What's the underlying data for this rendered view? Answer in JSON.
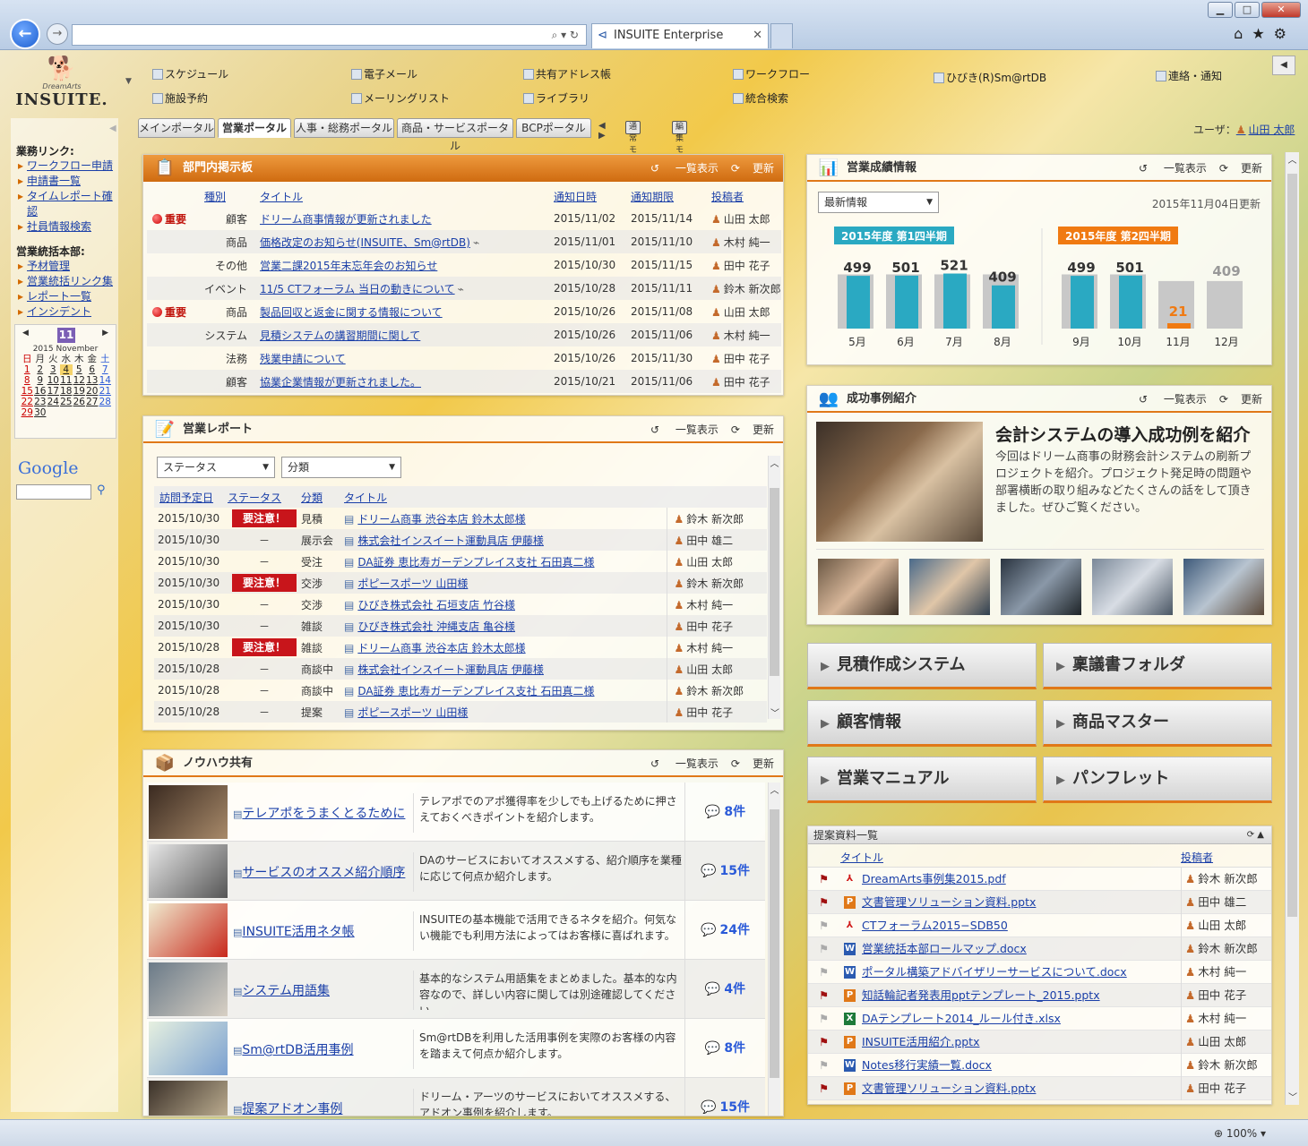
{
  "browser": {
    "address": "",
    "tab_title": "INSUITE Enterprise",
    "zoom": "100%"
  },
  "logo": {
    "sub": "DreamArts",
    "brand": "INSUITE."
  },
  "menu": [
    "スケジュール",
    "施設予約",
    "電子メール",
    "メーリングリスト",
    "共有アドレス帳",
    "ライブラリ",
    "ワークフロー",
    "統合検索",
    "ひびき(R)Sm@rtDB",
    "連絡・通知"
  ],
  "tabs": [
    "メインポータル",
    "営業ポータル",
    "人事・総務ポータル",
    "商品・サービスポータル",
    "BCPポータル"
  ],
  "modes": [
    "通常モード",
    "編集モード"
  ],
  "user": {
    "label": "ユーザ：",
    "name": "山田 太郎"
  },
  "sidebar": {
    "group1": {
      "title": "業務リンク:",
      "items": [
        "ワークフロー申請",
        "申請書一覧",
        "タイムレポート確認",
        "社員情報検索"
      ]
    },
    "group2": {
      "title": "営業統括本部:",
      "items": [
        "予材管理",
        "営業統括リンク集",
        "レポート一覧",
        "インシデント"
      ]
    },
    "calendar": {
      "month_num": "11",
      "month_label": "2015 November",
      "weekdays": [
        "日",
        "月",
        "火",
        "水",
        "木",
        "金",
        "土"
      ],
      "days": [
        "1",
        "2",
        "3",
        "4",
        "5",
        "6",
        "7",
        "8",
        "9",
        "10",
        "11",
        "12",
        "13",
        "14",
        "15",
        "16",
        "17",
        "18",
        "19",
        "20",
        "21",
        "22",
        "23",
        "24",
        "25",
        "26",
        "27",
        "28",
        "29",
        "30"
      ]
    },
    "google": "Google"
  },
  "bulletin": {
    "title": "部門内掲示板",
    "list_label": "一覧表示",
    "refresh_label": "更新",
    "headers": [
      "種別",
      "タイトル",
      "通知日時",
      "通知期限",
      "投稿者"
    ],
    "rows": [
      {
        "flag": "重要",
        "type": "顧客",
        "title": "ドリーム商事情報が更新されました",
        "date": "2015/11/02",
        "limit": "2015/11/14",
        "author": "山田 太郎"
      },
      {
        "flag": "",
        "type": "商品",
        "title": "価格改定のお知らせ(INSUITE、Sm@rtDB)",
        "date": "2015/11/01",
        "limit": "2015/11/10",
        "author": "木村 純一"
      },
      {
        "flag": "",
        "type": "その他",
        "title": "営業二課2015年末忘年会のお知らせ",
        "date": "2015/10/30",
        "limit": "2015/11/15",
        "author": "田中 花子"
      },
      {
        "flag": "",
        "type": "イベント",
        "title": "11/5 CTフォーラム 当日の動きについて",
        "date": "2015/10/28",
        "limit": "2015/11/11",
        "author": "鈴木 新次郎"
      },
      {
        "flag": "重要",
        "type": "商品",
        "title": "製品回収と返金に関する情報について",
        "date": "2015/10/26",
        "limit": "2015/11/08",
        "author": "山田 太郎"
      },
      {
        "flag": "",
        "type": "システム",
        "title": "見積システムの講習期間に関して",
        "date": "2015/10/26",
        "limit": "2015/11/06",
        "author": "木村 純一"
      },
      {
        "flag": "",
        "type": "法務",
        "title": "残業申請について",
        "date": "2015/10/26",
        "limit": "2015/11/30",
        "author": "田中 花子"
      },
      {
        "flag": "",
        "type": "顧客",
        "title": "協業企業情報が更新されました。",
        "date": "2015/10/21",
        "limit": "2015/11/06",
        "author": "田中 花子"
      }
    ]
  },
  "reports": {
    "title": "営業レポート",
    "list_label": "一覧表示",
    "refresh_label": "更新",
    "filter1": "ステータス",
    "filter2": "分類",
    "headers": [
      "訪問予定日",
      "ステータス",
      "分類",
      "タイトル"
    ],
    "rows": [
      {
        "date": "2015/10/30",
        "status": "要注意！",
        "cat": "見積",
        "title": "ドリーム商事 渋谷本店 鈴木太郎様",
        "author": "鈴木 新次郎"
      },
      {
        "date": "2015/10/30",
        "status": "－",
        "cat": "展示会",
        "title": "株式会社インスイート運動具店 伊藤様",
        "author": "田中 雄二"
      },
      {
        "date": "2015/10/30",
        "status": "－",
        "cat": "受注",
        "title": "DA証券 恵比寿ガーデンプレイス支社 石田真二様",
        "author": "山田 太郎"
      },
      {
        "date": "2015/10/30",
        "status": "要注意！",
        "cat": "交渉",
        "title": "ポピースポーツ 山田様",
        "author": "鈴木 新次郎"
      },
      {
        "date": "2015/10/30",
        "status": "－",
        "cat": "交渉",
        "title": "ひびき株式会社 石垣支店 竹谷様",
        "author": "木村 純一"
      },
      {
        "date": "2015/10/30",
        "status": "－",
        "cat": "雑談",
        "title": "ひびき株式会社 沖縄支店 亀谷様",
        "author": "田中 花子"
      },
      {
        "date": "2015/10/28",
        "status": "要注意！",
        "cat": "雑談",
        "title": "ドリーム商事 渋谷本店 鈴木太郎様",
        "author": "木村 純一"
      },
      {
        "date": "2015/10/28",
        "status": "－",
        "cat": "商談中",
        "title": "株式会社インスイート運動具店 伊藤様",
        "author": "山田 太郎"
      },
      {
        "date": "2015/10/28",
        "status": "－",
        "cat": "商談中",
        "title": "DA証券 恵比寿ガーデンプレイス支社 石田真二様",
        "author": "鈴木 新次郎"
      },
      {
        "date": "2015/10/28",
        "status": "－",
        "cat": "提案",
        "title": "ポピースポーツ 山田様",
        "author": "田中 花子"
      }
    ]
  },
  "knowhow": {
    "title": "ノウハウ共有",
    "list_label": "一覧表示",
    "refresh_label": "更新",
    "rows": [
      {
        "title": "テレアポをうまくとるために",
        "desc": "テレアポでのアポ獲得率を少しでも上げるために押さえておくべきポイントを紹介します。",
        "count": "8件"
      },
      {
        "title": "サービスのオススメ紹介順序",
        "desc": "DAのサービスにおいてオススメする、紹介順序を業種に応じて何点か紹介します。",
        "count": "15件"
      },
      {
        "title": "INSUITE活用ネタ帳",
        "desc": "INSUITEの基本機能で活用できるネタを紹介。何気ない機能でも利用方法によってはお客様に喜ばれます。",
        "count": "24件"
      },
      {
        "title": "システム用語集",
        "desc": "基本的なシステム用語集をまとめました。基本的な内容なので、詳しい内容に関しては別途確認してください。",
        "count": "4件"
      },
      {
        "title": "Sm@rtDB活用事例",
        "desc": "Sm@rtDBを利用した活用事例を実際のお客様の内容を踏まえて何点か紹介します。",
        "count": "8件"
      },
      {
        "title": "提案アドオン事例",
        "desc": "ドリーム・アーツのサービスにおいてオススメする、アドオン事例を紹介します。",
        "count": "15件"
      }
    ]
  },
  "sales": {
    "title": "営業成績情報",
    "list_label": "一覧表示",
    "refresh_label": "更新",
    "select": "最新情報",
    "updated": "2015年11月04日更新",
    "q1_label": "2015年度 第1四半期",
    "q2_label": "2015年度 第2四半期",
    "colors": {
      "actual": "#2aa9c2",
      "target": "#c8c8c8",
      "current": "#f07a12"
    }
  },
  "chart_data": [
    {
      "type": "bar",
      "title": "2015年度 第1四半期",
      "categories": [
        "5月",
        "6月",
        "7月",
        "8月"
      ],
      "series": [
        {
          "values": [
            499,
            501,
            521,
            409
          ]
        }
      ]
    },
    {
      "type": "bar",
      "title": "2015年度 第2四半期",
      "categories": [
        "9月",
        "10月",
        "11月",
        "12月"
      ],
      "series": [
        {
          "values": [
            499,
            501,
            21,
            409
          ]
        }
      ]
    }
  ],
  "success": {
    "title": "成功事例紹介",
    "list_label": "一覧表示",
    "refresh_label": "更新",
    "headline": "会計システムの導入成功例を紹介",
    "body": "今回はドリーム商事の財務会計システムの刷新プロジェクトを紹介。プロジェクト発足時の問題や部署横断の取り組みなどたくさんの話をして頂きました。ぜひご覧ください。"
  },
  "bigbuttons": [
    "見積作成システム",
    "稟議書フォルダ",
    "顧客情報",
    "商品マスター",
    "営業マニュアル",
    "パンフレット"
  ],
  "proposals": {
    "title": "提案資料一覧",
    "headers": [
      "タイトル",
      "投稿者"
    ],
    "rows": [
      {
        "flag": "red",
        "icon": "pdf",
        "name": "DreamArts事例集2015.pdf",
        "author": "鈴木 新次郎"
      },
      {
        "flag": "red",
        "icon": "ppt",
        "name": "文書管理ソリューション資料.pptx",
        "author": "田中 雄二"
      },
      {
        "flag": "gray",
        "icon": "pdf",
        "name": "CTフォーラム2015−SDB50",
        "author": "山田 太郎"
      },
      {
        "flag": "gray",
        "icon": "doc",
        "name": "営業統括本部ロールマップ.docx",
        "author": "鈴木 新次郎"
      },
      {
        "flag": "gray",
        "icon": "doc",
        "name": "ポータル構築アドバイザリーサービスについて.docx",
        "author": "木村 純一"
      },
      {
        "flag": "red",
        "icon": "ppt",
        "name": "知話輪記者発表用pptテンプレート_2015.pptx",
        "author": "田中 花子"
      },
      {
        "flag": "gray",
        "icon": "xls",
        "name": "DAテンプレート2014_ルール付き.xlsx",
        "author": "木村 純一"
      },
      {
        "flag": "red",
        "icon": "ppt",
        "name": "INSUITE活用紹介.pptx",
        "author": "山田 太郎"
      },
      {
        "flag": "gray",
        "icon": "doc",
        "name": "Notes移行実績一覧.docx",
        "author": "鈴木 新次郎"
      },
      {
        "flag": "red",
        "icon": "ppt",
        "name": "文書管理ソリューション資料.pptx",
        "author": "田中 花子"
      }
    ]
  }
}
